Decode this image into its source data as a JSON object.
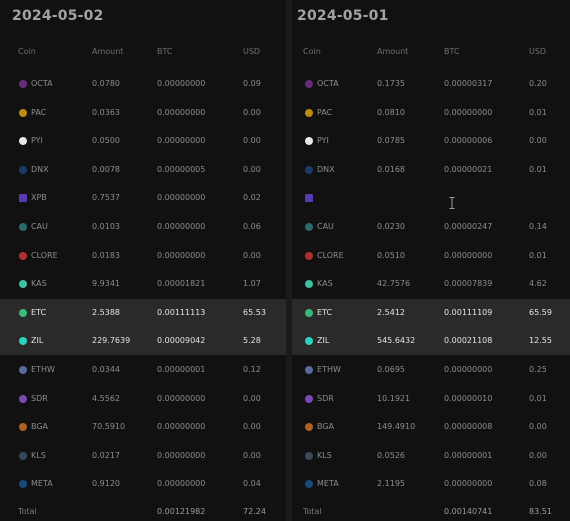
{
  "left": {
    "date": "2024-05-02",
    "headers": {
      "coin": "Coin",
      "amount": "Amount",
      "btc": "BTC",
      "usd": "USD"
    },
    "rows": [
      {
        "coin": "OCTA",
        "amount": "0.0780",
        "btc": "0.00000000",
        "usd": "0.09",
        "icon": "octa-icon",
        "color": "#6a2a7a"
      },
      {
        "coin": "PAC",
        "amount": "0.0363",
        "btc": "0.00000000",
        "usd": "0.00",
        "icon": "pac-icon",
        "color": "#c08a10"
      },
      {
        "coin": "PYI",
        "amount": "0.0500",
        "btc": "0.00000000",
        "usd": "0.00",
        "icon": "pyi-icon",
        "color": "#e8e8e8"
      },
      {
        "coin": "DNX",
        "amount": "0.0078",
        "btc": "0.00000005",
        "usd": "0.00",
        "icon": "dnx-icon",
        "color": "#1d3a6a"
      },
      {
        "coin": "XPB",
        "amount": "0.7537",
        "btc": "0.00000000",
        "usd": "0.02",
        "icon": "xpb-icon",
        "color": "#5a3ab0"
      },
      {
        "coin": "CAU",
        "amount": "0.0103",
        "btc": "0.00000000",
        "usd": "0.06",
        "icon": "cau-icon",
        "color": "#2a6a6a"
      },
      {
        "coin": "CLORE",
        "amount": "0.0183",
        "btc": "0.00000000",
        "usd": "0.00",
        "icon": "clore-icon",
        "color": "#b03030"
      },
      {
        "coin": "KAS",
        "amount": "9.9341",
        "btc": "0.00001821",
        "usd": "1.07",
        "icon": "kas-icon",
        "color": "#40c0a0"
      },
      {
        "coin": "ETC",
        "amount": "2.5388",
        "btc": "0.00111113",
        "usd": "65.53",
        "icon": "etc-icon",
        "color": "#3ab87a"
      },
      {
        "coin": "ZIL",
        "amount": "229.7639",
        "btc": "0.00009042",
        "usd": "5.28",
        "icon": "zil-icon",
        "color": "#29d3c0"
      },
      {
        "coin": "ETHW",
        "amount": "0.0344",
        "btc": "0.00000001",
        "usd": "0.12",
        "icon": "ethw-icon",
        "color": "#5a6aa0"
      },
      {
        "coin": "SDR",
        "amount": "4.5562",
        "btc": "0.00000000",
        "usd": "0.00",
        "icon": "sdr-icon",
        "color": "#7a4ab0"
      },
      {
        "coin": "BGA",
        "amount": "70.5910",
        "btc": "0.00000000",
        "usd": "0.00",
        "icon": "bga-icon",
        "color": "#b06020"
      },
      {
        "coin": "KLS",
        "amount": "0.0217",
        "btc": "0.00000000",
        "usd": "0.00",
        "icon": "kls-icon",
        "color": "#3a4a5a"
      },
      {
        "coin": "META",
        "amount": "0.9120",
        "btc": "0.00000000",
        "usd": "0.04",
        "icon": "meta-icon",
        "color": "#1a4a7a"
      }
    ],
    "total": {
      "label": "Total",
      "btc": "0.00121982",
      "usd": "72.24"
    }
  },
  "right": {
    "date": "2024-05-01",
    "headers": {
      "coin": "Coin",
      "amount": "Amount",
      "btc": "BTC",
      "usd": "USD"
    },
    "rows": [
      {
        "coin": "OCTA",
        "amount": "0.1735",
        "btc": "0.00000317",
        "usd": "0.20",
        "icon": "octa-icon",
        "color": "#6a2a7a"
      },
      {
        "coin": "PAC",
        "amount": "0.0810",
        "btc": "0.00000000",
        "usd": "0.01",
        "icon": "pac-icon",
        "color": "#c08a10"
      },
      {
        "coin": "PYI",
        "amount": "0.0785",
        "btc": "0.00000006",
        "usd": "0.00",
        "icon": "pyi-icon",
        "color": "#e8e8e8"
      },
      {
        "coin": "DNX",
        "amount": "0.0168",
        "btc": "0.00000021",
        "usd": "0.01",
        "icon": "dnx-icon",
        "color": "#1d3a6a"
      },
      {
        "coin": "",
        "amount": "",
        "btc": "",
        "usd": "",
        "icon": "xpb-icon",
        "color": "#5a3ab0"
      },
      {
        "coin": "CAU",
        "amount": "0.0230",
        "btc": "0.00000247",
        "usd": "0.14",
        "icon": "cau-icon",
        "color": "#2a6a6a"
      },
      {
        "coin": "CLORE",
        "amount": "0.0510",
        "btc": "0.00000000",
        "usd": "0.01",
        "icon": "clore-icon",
        "color": "#b03030"
      },
      {
        "coin": "KAS",
        "amount": "42.7576",
        "btc": "0.00007839",
        "usd": "4.62",
        "icon": "kas-icon",
        "color": "#40c0a0"
      },
      {
        "coin": "ETC",
        "amount": "2.5412",
        "btc": "0.00111109",
        "usd": "65.59",
        "icon": "etc-icon",
        "color": "#3ab87a"
      },
      {
        "coin": "ZIL",
        "amount": "545.6432",
        "btc": "0.00021108",
        "usd": "12.55",
        "icon": "zil-icon",
        "color": "#29d3c0"
      },
      {
        "coin": "ETHW",
        "amount": "0.0695",
        "btc": "0.00000000",
        "usd": "0.25",
        "icon": "ethw-icon",
        "color": "#5a6aa0"
      },
      {
        "coin": "SDR",
        "amount": "10.1921",
        "btc": "0.00000010",
        "usd": "0.01",
        "icon": "sdr-icon",
        "color": "#7a4ab0"
      },
      {
        "coin": "BGA",
        "amount": "149.4910",
        "btc": "0.00000008",
        "usd": "0.00",
        "icon": "bga-icon",
        "color": "#b06020"
      },
      {
        "coin": "KLS",
        "amount": "0.0526",
        "btc": "0.00000001",
        "usd": "0.00",
        "icon": "kls-icon",
        "color": "#3a4a5a"
      },
      {
        "coin": "META",
        "amount": "2.1195",
        "btc": "0.00000000",
        "usd": "0.08",
        "icon": "meta-icon",
        "color": "#1a4a7a"
      }
    ],
    "total": {
      "label": "Total",
      "btc": "0.00140741",
      "usd": "83.51"
    }
  },
  "highlighted_coins": [
    "ETC",
    "ZIL"
  ]
}
